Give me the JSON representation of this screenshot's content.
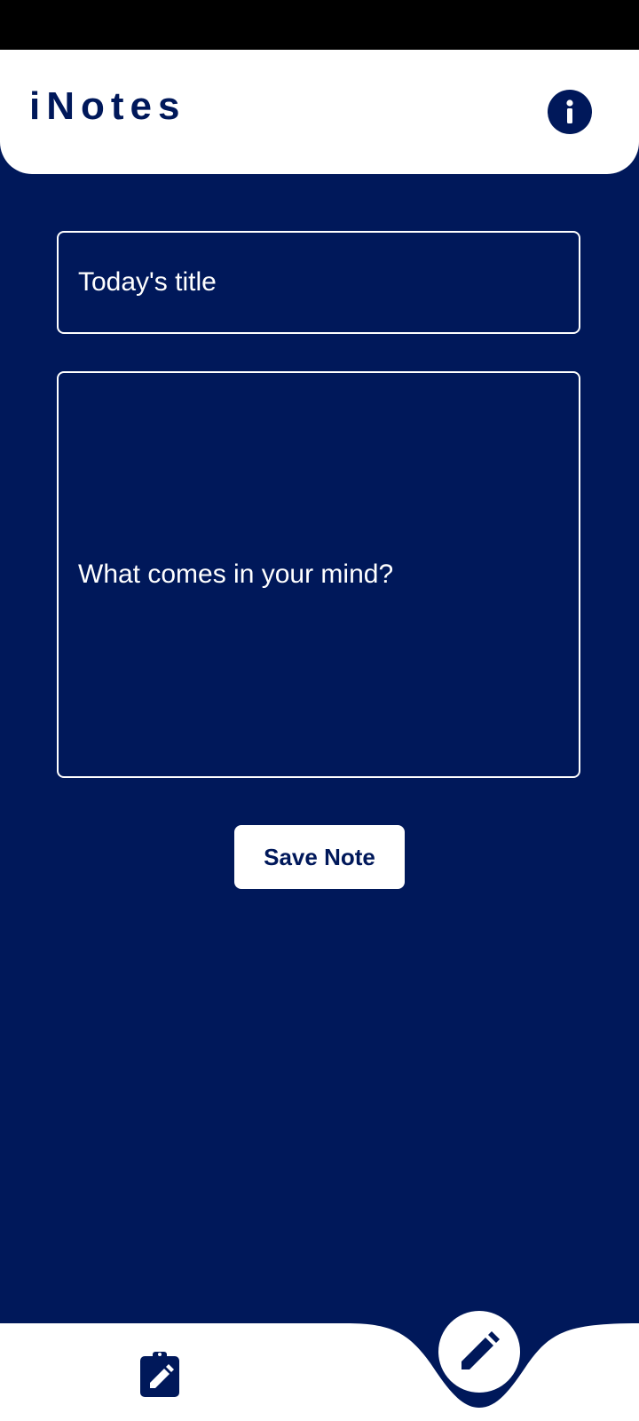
{
  "app": {
    "title": "iNotes"
  },
  "header": {
    "info_icon": "info-icon"
  },
  "form": {
    "title_placeholder": "Today's title",
    "body_placeholder": "What comes in your mind?",
    "save_label": "Save Note"
  },
  "bottom_nav": {
    "notes_icon": "clipboard-edit-icon",
    "write_icon": "pencil-icon"
  },
  "colors": {
    "primary": "#00185a",
    "surface": "#ffffff",
    "status_bar": "#000000"
  }
}
